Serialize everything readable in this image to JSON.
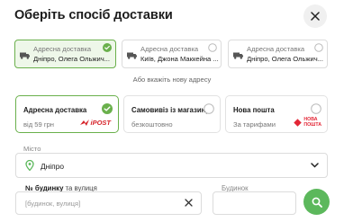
{
  "modal": {
    "title": "Оберіть спосіб доставки"
  },
  "saved_addresses": [
    {
      "type": "Адресна доставка",
      "address": "Дніпро, Олега Ольжич...",
      "selected": true
    },
    {
      "type": "Адресна доставка",
      "address": "Київ, Джона Маккейна ...",
      "selected": false
    },
    {
      "type": "Адресна доставка",
      "address": "Дніпро, Олега Ольжич...",
      "selected": false
    }
  ],
  "new_address_hint": "Або вкажіть нову адресу",
  "delivery_options": [
    {
      "title": "Адресна доставка",
      "subtitle": "від 59 грн",
      "logo": "ipost-logo",
      "selected": true
    },
    {
      "title": "Самовивіз із магазину",
      "subtitle": "безкоштовно",
      "logo": "",
      "selected": false
    },
    {
      "title": "Нова пошта",
      "subtitle": "За тарифами",
      "logo": "nova-poshta-logo",
      "selected": false
    }
  ],
  "logos": {
    "ipost": "iPOST",
    "nova_poshta_line1": "НОВА",
    "nova_poshta_line2": "ПОШТА"
  },
  "city": {
    "label": "Місто",
    "value": "Дніпро"
  },
  "street": {
    "label_bold": "№ будинку",
    "label_rest": " та вулиця",
    "placeholder": "[будинок, вулиця]"
  },
  "house": {
    "label": "Будинок",
    "value": ""
  },
  "colors": {
    "accent_green": "#5cb85c",
    "selected_border": "#6ab04c",
    "ipost_red": "#d6232a",
    "nova_poshta_red": "#e32636"
  }
}
